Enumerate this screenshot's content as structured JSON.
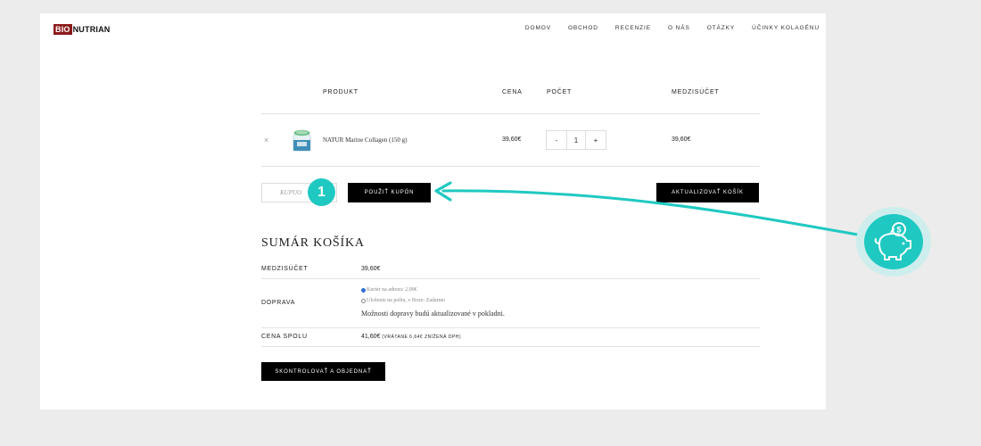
{
  "header": {
    "logo_bio": "BIO",
    "logo_rest": "NUTRIAN",
    "nav": [
      "DOMOV",
      "OBCHOD",
      "RECENZIE",
      "O NÁS",
      "OTÁZKY",
      "ÚČINKY KOLAGÉNU"
    ]
  },
  "cart": {
    "columns": {
      "product": "PRODUKT",
      "price": "CENA",
      "quantity": "POČET",
      "subtotal": "MEDZISÚČET"
    },
    "item": {
      "remove": "×",
      "name": "NATUR Marine Collagen (150 g)",
      "price": "39,60€",
      "qty_minus": "-",
      "qty": "1",
      "qty_plus": "+",
      "subtotal": "39,60€"
    },
    "coupon_placeholder": "KUPUO",
    "apply_coupon": "POUŽIŤ KUPÓN",
    "update_cart": "AKTUALIZOVAŤ KOŠÍK"
  },
  "annotation": {
    "step_number": "1",
    "accent_color": "#1fc9c2",
    "icon": "piggy-bank-coin-icon"
  },
  "summary": {
    "title": "SUMÁR KOŠÍKA",
    "subtotal_label": "MEDZISÚČET",
    "subtotal_value": "39,60€",
    "shipping_label": "DOPRAVA",
    "shipping_options": [
      "Kuriér na adresu: 2,00€",
      "Uloženie na poštu, v Boxe: Zadarmo"
    ],
    "shipping_note": "Možnosti dopravy budú aktualizované v pokladni.",
    "total_label": "CENA SPOLU",
    "total_value": "41,60€",
    "total_note": "(VRÁTANE 6,64€ ZNÍŽENÁ DPH)",
    "checkout": "SKONTROLOVAŤ A OBJEDNAŤ"
  }
}
